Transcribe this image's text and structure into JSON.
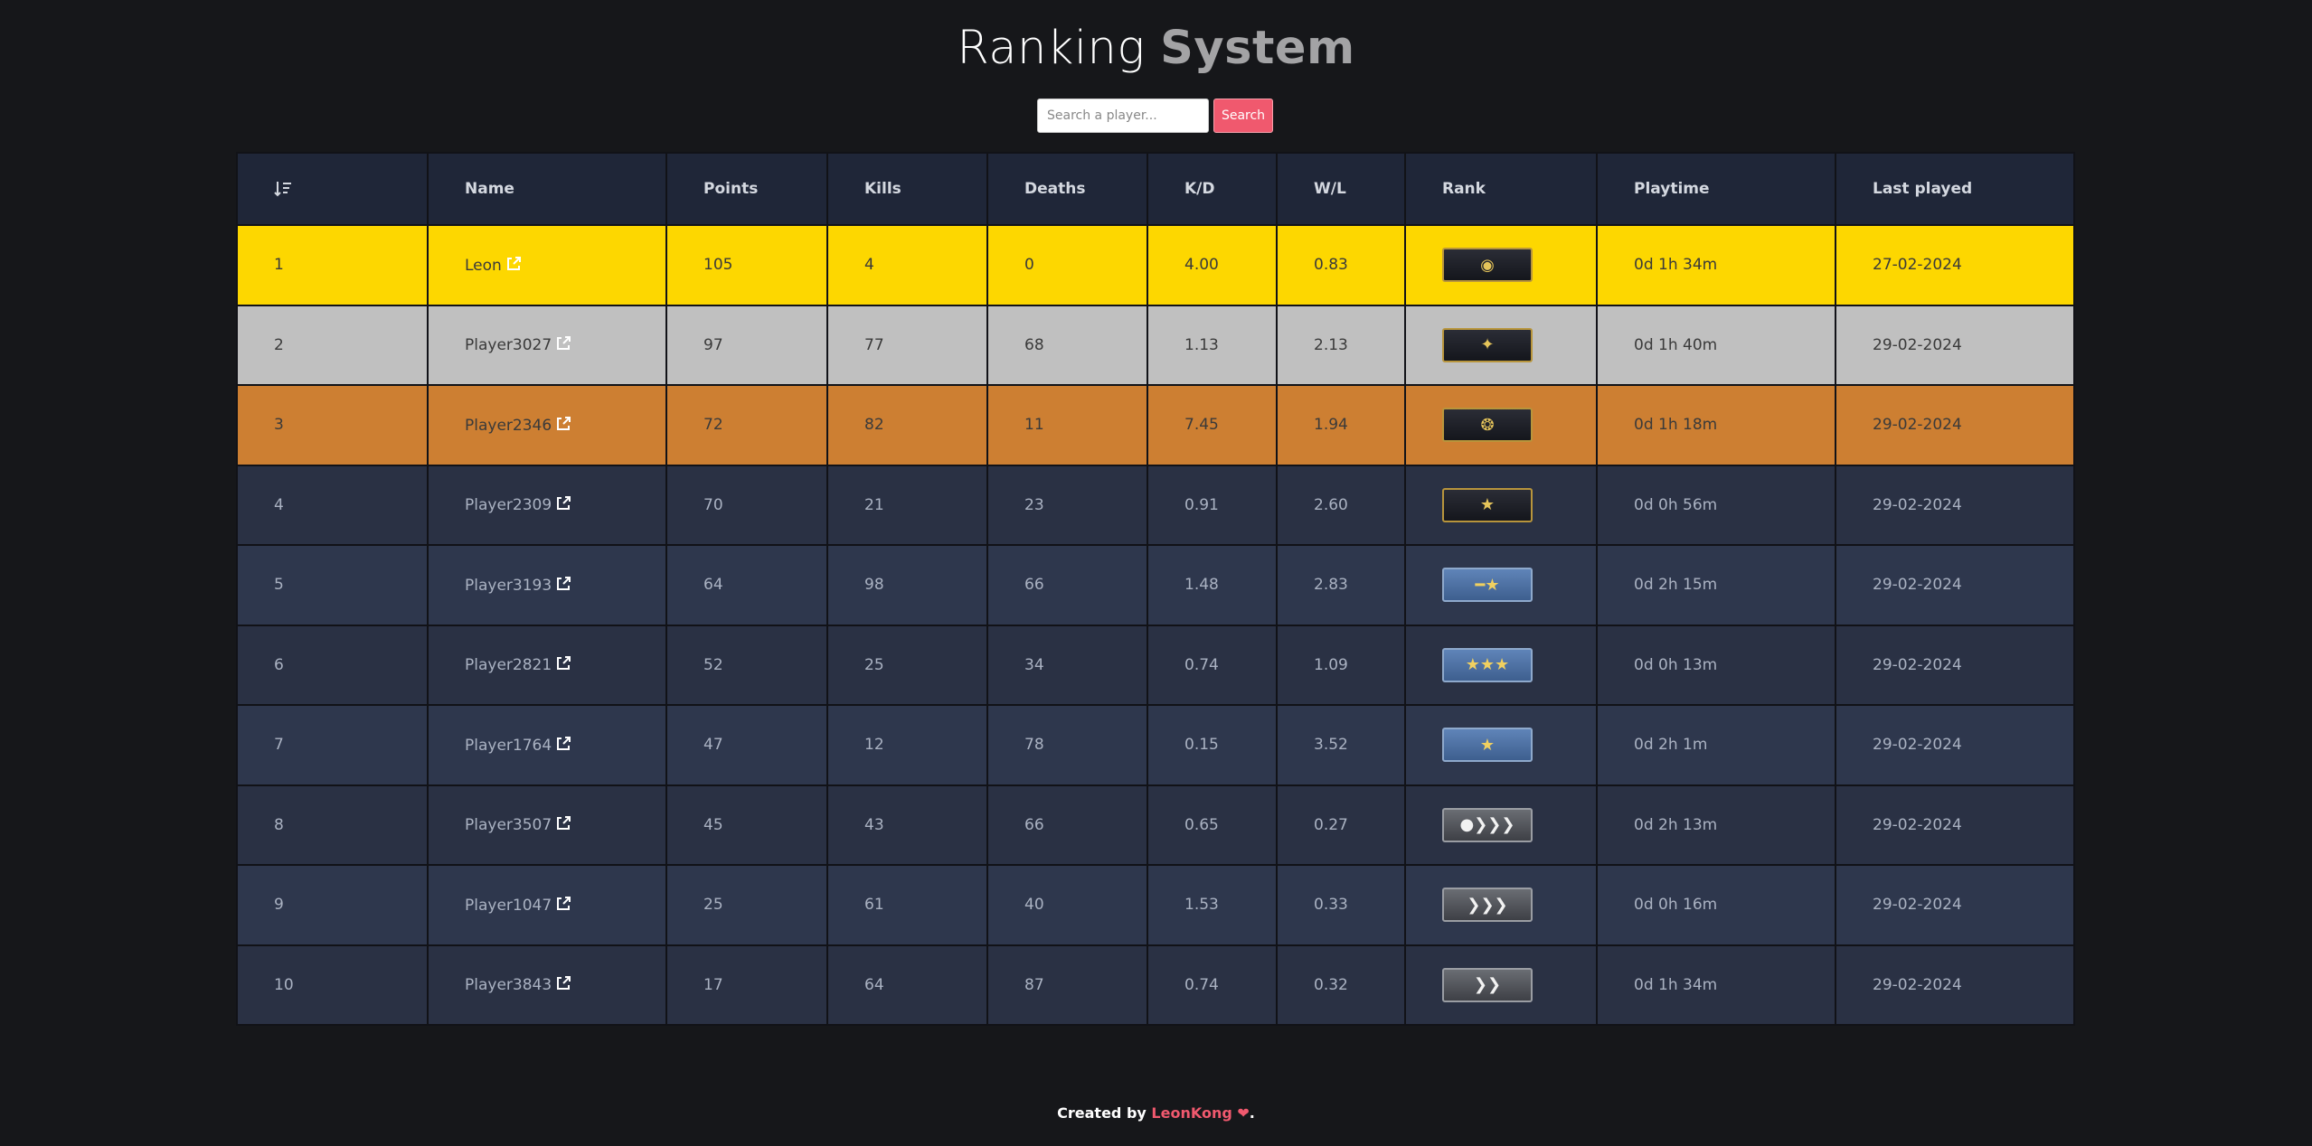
{
  "title": {
    "light": "Ranking ",
    "strong": "System"
  },
  "search": {
    "placeholder": "Search a player...",
    "button": "Search"
  },
  "headers": {
    "name": "Name",
    "points": "Points",
    "kills": "Kills",
    "deaths": "Deaths",
    "kd": "K/D",
    "wl": "W/L",
    "rank": "Rank",
    "playtime": "Playtime",
    "last": "Last played"
  },
  "rows": [
    {
      "pos": "1",
      "name": "Leon",
      "points": "105",
      "kills": "4",
      "deaths": "0",
      "kd": "4.00",
      "wl": "0.83",
      "rank_icon": "global-elite-rank-icon",
      "playtime": "0d 1h 34m",
      "last": "27-02-2024"
    },
    {
      "pos": "2",
      "name": "Player3027",
      "points": "97",
      "kills": "77",
      "deaths": "68",
      "kd": "1.13",
      "wl": "2.13",
      "rank_icon": "supreme-master-rank-icon",
      "playtime": "0d 1h 40m",
      "last": "29-02-2024"
    },
    {
      "pos": "3",
      "name": "Player2346",
      "points": "72",
      "kills": "82",
      "deaths": "11",
      "kd": "7.45",
      "wl": "1.94",
      "rank_icon": "legendary-eagle-rank-icon",
      "playtime": "0d 1h 18m",
      "last": "29-02-2024"
    },
    {
      "pos": "4",
      "name": "Player2309",
      "points": "70",
      "kills": "21",
      "deaths": "23",
      "kd": "0.91",
      "wl": "2.60",
      "rank_icon": "distinguished-master-guardian-rank-icon",
      "playtime": "0d 0h 56m",
      "last": "29-02-2024"
    },
    {
      "pos": "5",
      "name": "Player3193",
      "points": "64",
      "kills": "98",
      "deaths": "66",
      "kd": "1.48",
      "wl": "2.83",
      "rank_icon": "master-guardian-elite-rank-icon",
      "playtime": "0d 2h 15m",
      "last": "29-02-2024"
    },
    {
      "pos": "6",
      "name": "Player2821",
      "points": "52",
      "kills": "25",
      "deaths": "34",
      "kd": "0.74",
      "wl": "1.09",
      "rank_icon": "gold-nova-3-rank-icon",
      "playtime": "0d 0h 13m",
      "last": "29-02-2024"
    },
    {
      "pos": "7",
      "name": "Player1764",
      "points": "47",
      "kills": "12",
      "deaths": "78",
      "kd": "0.15",
      "wl": "3.52",
      "rank_icon": "gold-nova-1-rank-icon",
      "playtime": "0d 2h 1m",
      "last": "29-02-2024"
    },
    {
      "pos": "8",
      "name": "Player3507",
      "points": "45",
      "kills": "43",
      "deaths": "66",
      "kd": "0.65",
      "wl": "0.27",
      "rank_icon": "silver-elite-master-rank-icon",
      "playtime": "0d 2h 13m",
      "last": "29-02-2024"
    },
    {
      "pos": "9",
      "name": "Player1047",
      "points": "25",
      "kills": "61",
      "deaths": "40",
      "kd": "1.53",
      "wl": "0.33",
      "rank_icon": "silver-3-rank-icon",
      "playtime": "0d 0h 16m",
      "last": "29-02-2024"
    },
    {
      "pos": "10",
      "name": "Player3843",
      "points": "17",
      "kills": "64",
      "deaths": "87",
      "kd": "0.74",
      "wl": "0.32",
      "rank_icon": "silver-2-rank-icon",
      "playtime": "0d 1h 34m",
      "last": "29-02-2024"
    }
  ],
  "footer": {
    "prefix": "Created by ",
    "author": "LeonKong",
    "suffix": "."
  },
  "colors": {
    "gold": "#fdd700",
    "silver": "#c0c0c0",
    "bronze": "#cd7f32",
    "accent": "#f0596e",
    "header": "#1f2638"
  }
}
